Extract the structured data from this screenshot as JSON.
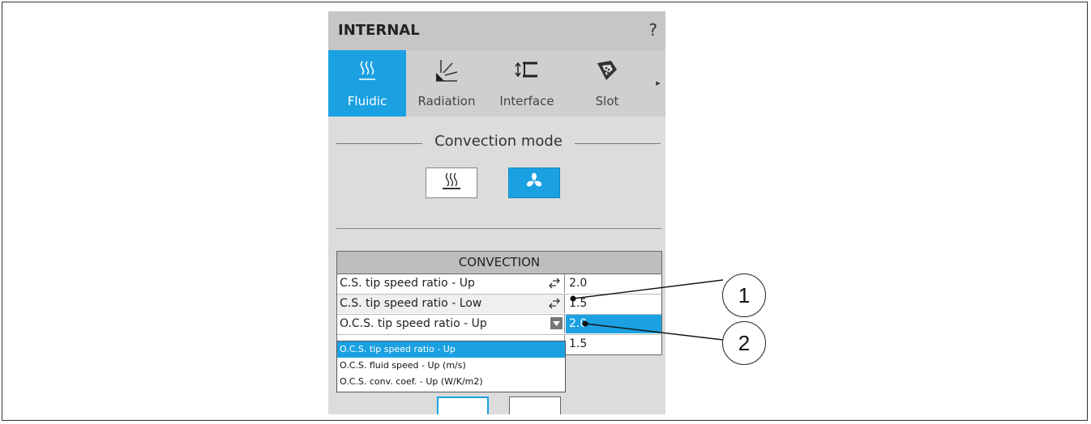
{
  "panel": {
    "title": "INTERNAL",
    "help": "?"
  },
  "tabs": [
    {
      "label": "Fluidic",
      "icon": "heat-waves-icon",
      "active": true
    },
    {
      "label": "Radiation",
      "icon": "radiation-icon",
      "active": false
    },
    {
      "label": "Interface",
      "icon": "interface-icon",
      "active": false
    },
    {
      "label": "Slot",
      "icon": "slot-icon",
      "active": false
    }
  ],
  "tab_more_arrow": "▸",
  "convection_mode": {
    "label": "Convection mode",
    "options": [
      {
        "icon": "natural-convection-icon",
        "active": false
      },
      {
        "icon": "fan-icon",
        "active": true
      }
    ]
  },
  "convection_table": {
    "header": "CONVECTION",
    "rows": [
      {
        "name": "C.S. tip speed ratio - Up",
        "value": "2.0"
      },
      {
        "name": "C.S. tip speed ratio - Low",
        "value": "1.5"
      },
      {
        "name": "O.C.S. tip speed ratio - Up",
        "value": "2.0"
      },
      {
        "name": "",
        "value": "1.5"
      }
    ]
  },
  "dropdown": {
    "selected": "O.C.S. tip speed ratio - Up",
    "options": [
      "O.C.S. tip speed ratio - Up",
      "O.C.S. fluid speed - Up (m/s)",
      "O.C.S. conv. coef. - Up (W/K/m2)"
    ]
  },
  "callouts": [
    "1",
    "2"
  ],
  "colors": {
    "accent": "#1ba1e2",
    "panel_bg": "#dcdcdc",
    "header_bg": "#c6c6c6"
  }
}
